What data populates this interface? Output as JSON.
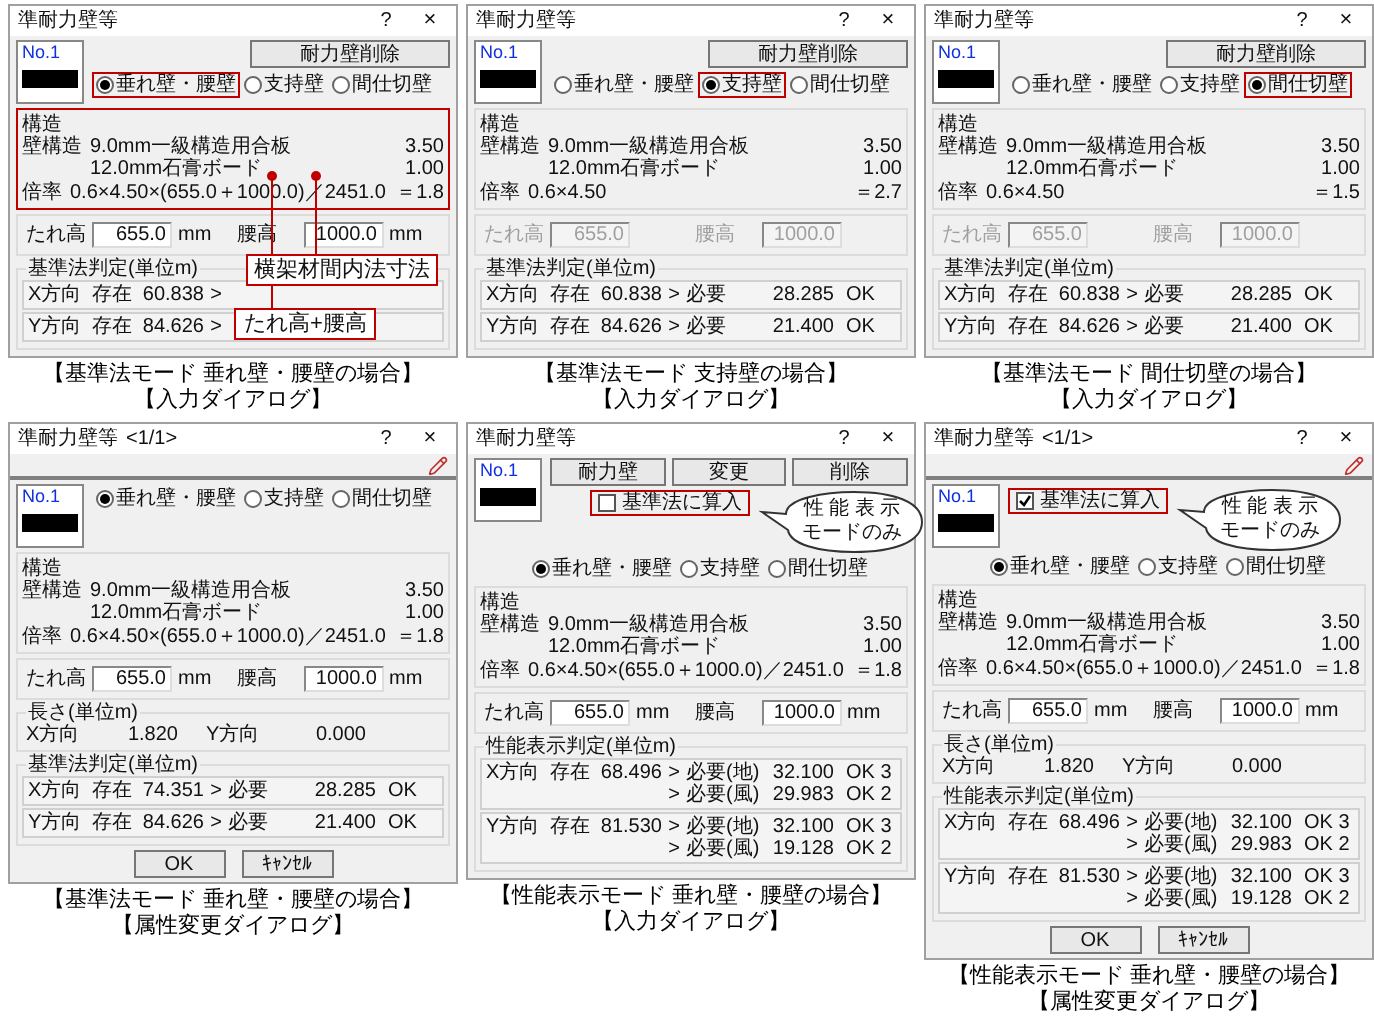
{
  "dialogs": [
    {
      "kind": "input",
      "title": "準耐力壁等",
      "help": "?",
      "close": "×",
      "no_label": "No.1",
      "buttons": [
        "耐力壁削除"
      ],
      "wall_types": [
        {
          "label": "垂れ壁・腰壁",
          "selected": true,
          "highlighted": true
        },
        {
          "label": "支持壁",
          "selected": false,
          "highlighted": false
        },
        {
          "label": "間仕切壁",
          "selected": false,
          "highlighted": false
        }
      ],
      "structure": {
        "title": "構造",
        "highlighted": true,
        "wall_label": "壁構造",
        "materials": [
          {
            "name": "9.0mm一級構造用合板",
            "value": "3.50"
          },
          {
            "name": "12.0mm石膏ボード",
            "value": "1.00"
          }
        ],
        "rate_label": "倍率",
        "formula": "0.6×4.50×(655.0＋1000.0)／2451.0",
        "equals": "＝",
        "rate": "1.8"
      },
      "heights": {
        "disabled": false,
        "fields": [
          {
            "label": "たれ高",
            "value": "655.0",
            "unit": "mm"
          },
          {
            "label": "腰高",
            "value": "1000.0",
            "unit": "mm"
          }
        ]
      },
      "judgment": {
        "title": "基準法判定(単位m)",
        "rows": [
          {
            "direction": "X方向",
            "label": "存在",
            "value": "60.838",
            "checks": [
              {
                "op": ">"
              }
            ]
          },
          {
            "direction": "Y方向",
            "label": "存在",
            "value": "84.626",
            "checks": [
              {
                "op": ">"
              }
            ]
          }
        ]
      },
      "annotations": [
        "横架材間内法寸法",
        "たれ高+腰高"
      ],
      "caption": [
        "【基準法モード 垂れ壁・腰壁の場合】",
        "【入力ダイアログ】"
      ]
    },
    {
      "kind": "input",
      "title": "準耐力壁等",
      "help": "?",
      "close": "×",
      "no_label": "No.1",
      "buttons": [
        "耐力壁削除"
      ],
      "wall_types": [
        {
          "label": "垂れ壁・腰壁",
          "selected": false,
          "highlighted": false
        },
        {
          "label": "支持壁",
          "selected": true,
          "highlighted": true
        },
        {
          "label": "間仕切壁",
          "selected": false,
          "highlighted": false
        }
      ],
      "structure": {
        "title": "構造",
        "highlighted": false,
        "wall_label": "壁構造",
        "materials": [
          {
            "name": "9.0mm一級構造用合板",
            "value": "3.50"
          },
          {
            "name": "12.0mm石膏ボード",
            "value": "1.00"
          }
        ],
        "rate_label": "倍率",
        "formula": "0.6×4.50",
        "equals": "＝",
        "rate": "2.7"
      },
      "heights": {
        "disabled": true,
        "fields": [
          {
            "label": "たれ高",
            "value": "655.0"
          },
          {
            "label": "腰高",
            "value": "1000.0"
          }
        ]
      },
      "judgment": {
        "title": "基準法判定(単位m)",
        "rows": [
          {
            "direction": "X方向",
            "label": "存在",
            "value": "60.838",
            "checks": [
              {
                "op": ">",
                "label": "必要",
                "value": "28.285",
                "result": "OK"
              }
            ]
          },
          {
            "direction": "Y方向",
            "label": "存在",
            "value": "84.626",
            "checks": [
              {
                "op": ">",
                "label": "必要",
                "value": "21.400",
                "result": "OK"
              }
            ]
          }
        ]
      },
      "caption": [
        "【基準法モード 支持壁の場合】",
        "【入力ダイアログ】"
      ]
    },
    {
      "kind": "input",
      "title": "準耐力壁等",
      "help": "?",
      "close": "×",
      "no_label": "No.1",
      "buttons": [
        "耐力壁削除"
      ],
      "wall_types": [
        {
          "label": "垂れ壁・腰壁",
          "selected": false,
          "highlighted": false
        },
        {
          "label": "支持壁",
          "selected": false,
          "highlighted": false
        },
        {
          "label": "間仕切壁",
          "selected": true,
          "highlighted": true
        }
      ],
      "structure": {
        "title": "構造",
        "highlighted": false,
        "wall_label": "壁構造",
        "materials": [
          {
            "name": "9.0mm一級構造用合板",
            "value": "3.50"
          },
          {
            "name": "12.0mm石膏ボード",
            "value": "1.00"
          }
        ],
        "rate_label": "倍率",
        "formula": "0.6×4.50",
        "equals": "＝",
        "rate": "1.5"
      },
      "heights": {
        "disabled": true,
        "fields": [
          {
            "label": "たれ高",
            "value": "655.0"
          },
          {
            "label": "腰高",
            "value": "1000.0"
          }
        ]
      },
      "judgment": {
        "title": "基準法判定(単位m)",
        "rows": [
          {
            "direction": "X方向",
            "label": "存在",
            "value": "60.838",
            "checks": [
              {
                "op": ">",
                "label": "必要",
                "value": "28.285",
                "result": "OK"
              }
            ]
          },
          {
            "direction": "Y方向",
            "label": "存在",
            "value": "84.626",
            "checks": [
              {
                "op": ">",
                "label": "必要",
                "value": "21.400",
                "result": "OK"
              }
            ]
          }
        ]
      },
      "caption": [
        "【基準法モード 間仕切壁の場合】",
        "【入力ダイアログ】"
      ]
    },
    {
      "kind": "attribute",
      "title": "準耐力壁等",
      "page": "<1/1>",
      "help": "?",
      "close": "×",
      "no_label": "No.1",
      "wall_types": [
        {
          "label": "垂れ壁・腰壁",
          "selected": true,
          "highlighted": false
        },
        {
          "label": "支持壁",
          "selected": false,
          "highlighted": false
        },
        {
          "label": "間仕切壁",
          "selected": false,
          "highlighted": false
        }
      ],
      "structure": {
        "title": "構造",
        "highlighted": false,
        "wall_label": "壁構造",
        "materials": [
          {
            "name": "9.0mm一級構造用合板",
            "value": "3.50"
          },
          {
            "name": "12.0mm石膏ボード",
            "value": "1.00"
          }
        ],
        "rate_label": "倍率",
        "formula": "0.6×4.50×(655.0＋1000.0)／2451.0",
        "equals": "＝",
        "rate": "1.8"
      },
      "heights": {
        "disabled": false,
        "fields": [
          {
            "label": "たれ高",
            "value": "655.0",
            "unit": "mm"
          },
          {
            "label": "腰高",
            "value": "1000.0",
            "unit": "mm"
          }
        ]
      },
      "length": {
        "title": "長さ(単位m)",
        "x_label": "X方向",
        "x_value": "1.820",
        "y_label": "Y方向",
        "y_value": "0.000"
      },
      "judgment": {
        "title": "基準法判定(単位m)",
        "rows": [
          {
            "direction": "X方向",
            "label": "存在",
            "value": "74.351",
            "checks": [
              {
                "op": ">",
                "label": "必要",
                "value": "28.285",
                "result": "OK"
              }
            ]
          },
          {
            "direction": "Y方向",
            "label": "存在",
            "value": "84.626",
            "checks": [
              {
                "op": ">",
                "label": "必要",
                "value": "21.400",
                "result": "OK"
              }
            ]
          }
        ]
      },
      "footer": [
        "OK",
        "ｷｬﾝｾﾙ"
      ],
      "caption": [
        "【基準法モード 垂れ壁・腰壁の場合】",
        "【属性変更ダイアログ】"
      ]
    },
    {
      "kind": "input",
      "title": "準耐力壁等",
      "help": "?",
      "close": "×",
      "no_label": "No.1",
      "buttons": [
        "耐力壁",
        "変更",
        "削除"
      ],
      "checkbox": {
        "label": "基準法に算入",
        "checked": false,
        "highlighted": true
      },
      "bubble": [
        "性 能 表 示",
        "モードのみ"
      ],
      "wall_types": [
        {
          "label": "垂れ壁・腰壁",
          "selected": true,
          "highlighted": false
        },
        {
          "label": "支持壁",
          "selected": false,
          "highlighted": false
        },
        {
          "label": "間仕切壁",
          "selected": false,
          "highlighted": false
        }
      ],
      "structure": {
        "title": "構造",
        "highlighted": false,
        "wall_label": "壁構造",
        "materials": [
          {
            "name": "9.0mm一級構造用合板",
            "value": "3.50"
          },
          {
            "name": "12.0mm石膏ボード",
            "value": "1.00"
          }
        ],
        "rate_label": "倍率",
        "formula": "0.6×4.50×(655.0＋1000.0)／2451.0",
        "equals": "＝",
        "rate": "1.8"
      },
      "heights": {
        "disabled": false,
        "fields": [
          {
            "label": "たれ高",
            "value": "655.0",
            "unit": "mm"
          },
          {
            "label": "腰高",
            "value": "1000.0",
            "unit": "mm"
          }
        ]
      },
      "judgment": {
        "title": "性能表示判定(単位m)",
        "rows": [
          {
            "direction": "X方向",
            "label": "存在",
            "value": "68.496",
            "checks": [
              {
                "op": ">",
                "label": "必要(地)",
                "value": "32.100",
                "result": "OK 3"
              },
              {
                "op": ">",
                "label": "必要(風)",
                "value": "29.983",
                "result": "OK 2"
              }
            ]
          },
          {
            "direction": "Y方向",
            "label": "存在",
            "value": "81.530",
            "checks": [
              {
                "op": ">",
                "label": "必要(地)",
                "value": "32.100",
                "result": "OK 3"
              },
              {
                "op": ">",
                "label": "必要(風)",
                "value": "19.128",
                "result": "OK 2"
              }
            ]
          }
        ]
      },
      "caption": [
        "【性能表示モード 垂れ壁・腰壁の場合】",
        "【入力ダイアログ】"
      ]
    },
    {
      "kind": "attribute",
      "title": "準耐力壁等",
      "page": "<1/1>",
      "help": "?",
      "close": "×",
      "no_label": "No.1",
      "checkbox": {
        "label": "基準法に算入",
        "checked": true,
        "highlighted": true
      },
      "bubble": [
        "性 能 表 示",
        "モードのみ"
      ],
      "wall_types": [
        {
          "label": "垂れ壁・腰壁",
          "selected": true,
          "highlighted": false
        },
        {
          "label": "支持壁",
          "selected": false,
          "highlighted": false
        },
        {
          "label": "間仕切壁",
          "selected": false,
          "highlighted": false
        }
      ],
      "structure": {
        "title": "構造",
        "highlighted": false,
        "wall_label": "壁構造",
        "materials": [
          {
            "name": "9.0mm一級構造用合板",
            "value": "3.50"
          },
          {
            "name": "12.0mm石膏ボード",
            "value": "1.00"
          }
        ],
        "rate_label": "倍率",
        "formula": "0.6×4.50×(655.0＋1000.0)／2451.0",
        "equals": "＝",
        "rate": "1.8"
      },
      "heights": {
        "disabled": false,
        "fields": [
          {
            "label": "たれ高",
            "value": "655.0",
            "unit": "mm"
          },
          {
            "label": "腰高",
            "value": "1000.0",
            "unit": "mm"
          }
        ]
      },
      "length": {
        "title": "長さ(単位m)",
        "x_label": "X方向",
        "x_value": "1.820",
        "y_label": "Y方向",
        "y_value": "0.000"
      },
      "judgment": {
        "title": "性能表示判定(単位m)",
        "rows": [
          {
            "direction": "X方向",
            "label": "存在",
            "value": "68.496",
            "checks": [
              {
                "op": ">",
                "label": "必要(地)",
                "value": "32.100",
                "result": "OK 3"
              },
              {
                "op": ">",
                "label": "必要(風)",
                "value": "29.983",
                "result": "OK 2"
              }
            ]
          },
          {
            "direction": "Y方向",
            "label": "存在",
            "value": "81.530",
            "checks": [
              {
                "op": ">",
                "label": "必要(地)",
                "value": "32.100",
                "result": "OK 3"
              },
              {
                "op": ">",
                "label": "必要(風)",
                "value": "19.128",
                "result": "OK 2"
              }
            ]
          }
        ]
      },
      "footer": [
        "OK",
        "ｷｬﾝｾﾙ"
      ],
      "caption": [
        "【性能表示モード 垂れ壁・腰壁の場合】",
        "【属性変更ダイアログ】"
      ]
    }
  ]
}
